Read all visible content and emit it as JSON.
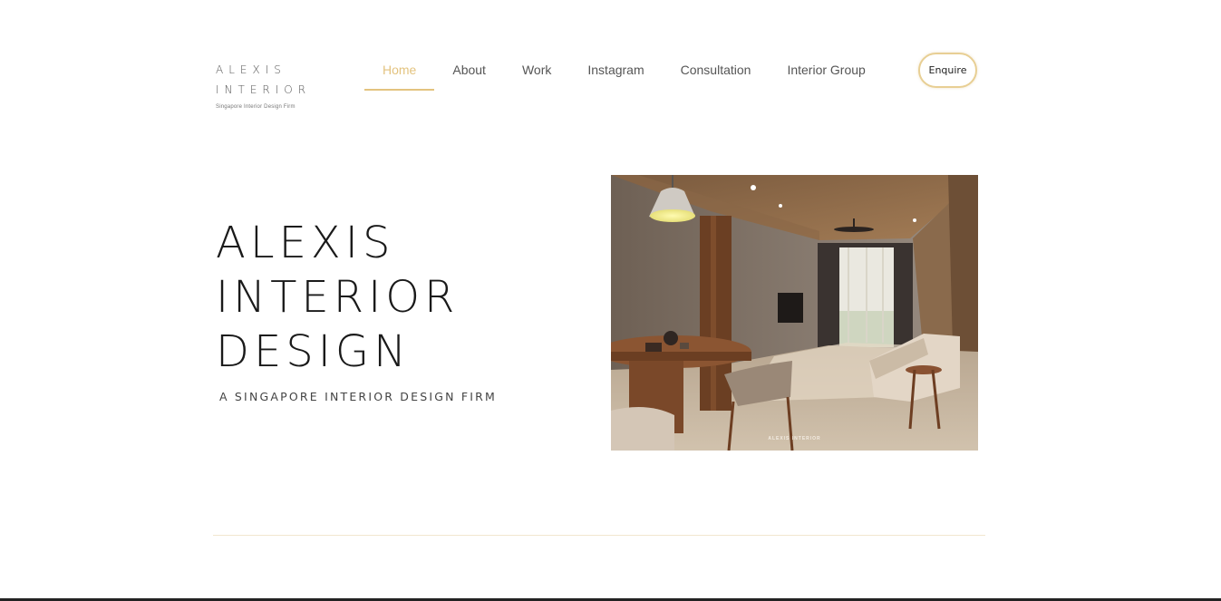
{
  "logo": {
    "line1": "ALEXIS",
    "line2": "INTERIOR",
    "tagline": "Singapore Interior Design Firm"
  },
  "nav": {
    "items": [
      {
        "label": "Home",
        "active": true
      },
      {
        "label": "About"
      },
      {
        "label": "Work"
      },
      {
        "label": "Instagram"
      },
      {
        "label": "Consultation"
      },
      {
        "label": "Interior Group"
      }
    ],
    "enquire_label": "Enquire"
  },
  "hero": {
    "title_lines": [
      "ALEXIS",
      "INTERIOR",
      "DESIGN"
    ],
    "subtitle": "A SINGAPORE INTERIOR DESIGN FIRM",
    "image_watermark": "ALEXIS INTERIOR"
  },
  "colors": {
    "accent": "#e3c37f",
    "text": "#1a1a1a",
    "divider": "#f1e6cf"
  }
}
